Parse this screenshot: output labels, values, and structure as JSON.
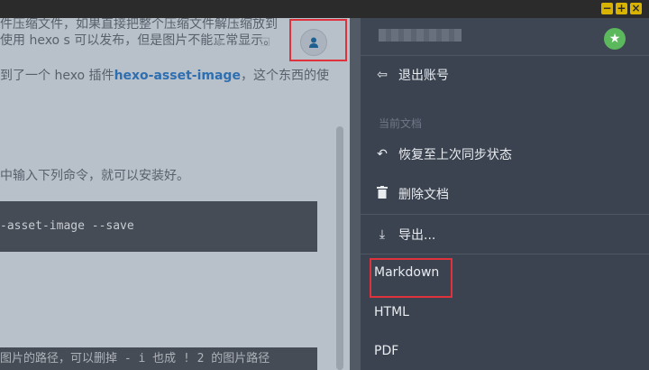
{
  "doc": {
    "line1": "件压缩文件，如果直接把整个压缩文件解压缩放到",
    "line2": "使用 hexo s 可以发布，但是图片不能正常显示。",
    "line3_pre": "到了一个 hexo 插件",
    "line3_link": "hexo-asset-image",
    "line3_post": "，这个东西的使",
    "line4": "中输入下列命令，就可以安装好。",
    "code1": "-asset-image --save",
    "code2": "图片的路径，可以删掉 - i 也成 ! 2 的图片路径"
  },
  "menu": {
    "logout": "退出账号",
    "section_current": "当前文档",
    "restore": "恢复至上次同步状态",
    "delete": "删除文档",
    "export": "导出...",
    "markdown": "Markdown",
    "html": "HTML",
    "pdf": "PDF"
  },
  "icons": {
    "logout": "logout-icon",
    "restore": "undo-icon",
    "delete": "trash-icon",
    "export": "download-icon",
    "star": "star-icon",
    "user": "user-icon"
  },
  "colors": {
    "highlight": "#e0323c",
    "badge": "#5cb85c",
    "link": "#2d6fb0"
  }
}
